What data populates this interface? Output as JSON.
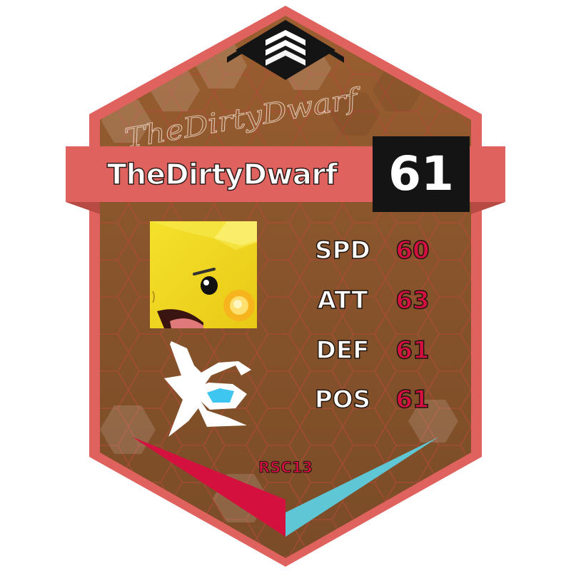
{
  "player": {
    "name": "TheDirtyDwarf",
    "signature": "TheDirtyDwarf",
    "rating": "61",
    "avatar_icon": "pikachu-avatar"
  },
  "stats": [
    {
      "label": "SPD",
      "value": "60"
    },
    {
      "label": "ATT",
      "value": "63"
    },
    {
      "label": "DEF",
      "value": "61"
    },
    {
      "label": "POS",
      "value": "61"
    }
  ],
  "season": "RSC13",
  "icons": {
    "top": "stacked-chevrons-logo",
    "team": "team-k-logo"
  },
  "colors": {
    "frame": "#e0625f",
    "card_fill": "#8a552b",
    "rating_bg": "#141414",
    "stat_value": "#d4103f",
    "accent_left": "#d4103f",
    "accent_right": "#5ec6d4"
  }
}
